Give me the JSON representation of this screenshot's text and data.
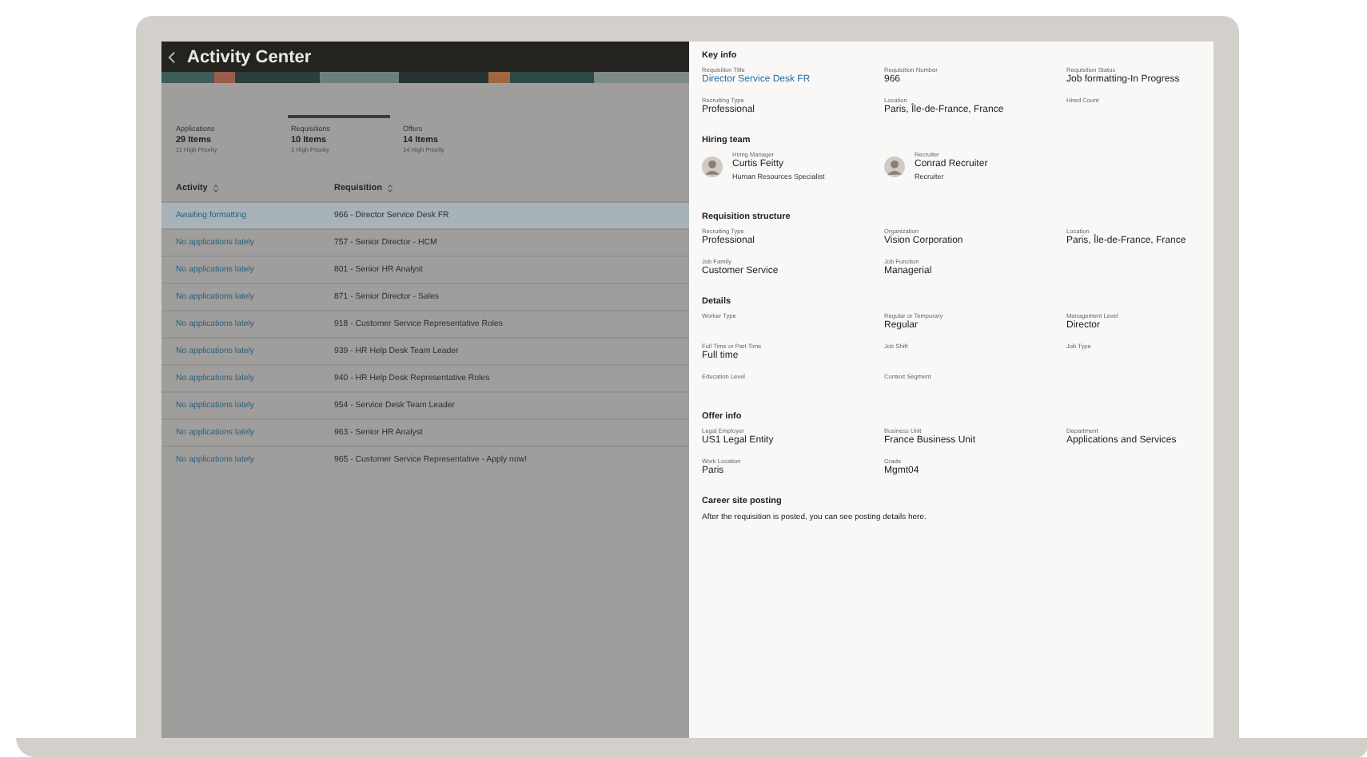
{
  "header": {
    "title": "Activity Center"
  },
  "tabs": [
    {
      "label": "Applications",
      "count": "29 Items",
      "priority": "11 High Priority",
      "selected": false
    },
    {
      "label": "Requisitions",
      "count": "10 Items",
      "priority": "1 High Priority",
      "selected": true
    },
    {
      "label": "Offers",
      "count": "14 Items",
      "priority": "14 High Priority",
      "selected": false
    }
  ],
  "table": {
    "columns": [
      {
        "label": "Activity"
      },
      {
        "label": "Requisition"
      }
    ],
    "rows": [
      {
        "activity": "Awaiting formatting",
        "requisition": "966 - Director Service Desk FR",
        "selected": true
      },
      {
        "activity": "No applications lately",
        "requisition": "757 - Senior Director - HCM",
        "selected": false
      },
      {
        "activity": "No applications lately",
        "requisition": "801 - Senior HR Analyst",
        "selected": false
      },
      {
        "activity": "No applications lately",
        "requisition": "871 - Senior Director - Sales",
        "selected": false
      },
      {
        "activity": "No applications lately",
        "requisition": "918 - Customer Service Representative Roles",
        "selected": false
      },
      {
        "activity": "No applications lately",
        "requisition": "939 - HR Help Desk Team Leader",
        "selected": false
      },
      {
        "activity": "No applications lately",
        "requisition": "940 - HR Help Desk Representative Roles",
        "selected": false
      },
      {
        "activity": "No applications lately",
        "requisition": "954 - Service Desk Team Leader",
        "selected": false
      },
      {
        "activity": "No applications lately",
        "requisition": "963 - Senior HR Analyst",
        "selected": false
      },
      {
        "activity": "No applications lately",
        "requisition": "965 - Customer Service Representative - Apply now!",
        "selected": false
      }
    ]
  },
  "panel": {
    "sections": [
      {
        "title": "Key info",
        "kind": "fields",
        "fields": [
          {
            "label": "Requisition Title",
            "value": "Director Service Desk FR",
            "link": true
          },
          {
            "label": "Requisition Number",
            "value": "966",
            "link": false
          },
          {
            "label": "Requisition Status",
            "value": "Job formatting-In Progress",
            "link": false
          },
          {
            "label": "Recruiting Type",
            "value": "Professional",
            "link": false
          },
          {
            "label": "Location",
            "value": "Paris, Île-de-France, France",
            "link": false
          },
          {
            "label": "Hired Count"
          }
        ]
      },
      {
        "title": "Hiring team",
        "kind": "people",
        "people": [
          {
            "role": "Hiring Manager",
            "name": "Curtis Feitty",
            "subtitle": "Human Resources Specialist"
          },
          {
            "role": "Recruiter",
            "name": "Conrad Recruiter",
            "subtitle": "Recruiter"
          }
        ]
      },
      {
        "title": "Requisition structure",
        "kind": "fields",
        "fields": [
          {
            "label": "Recruiting Type",
            "value": "Professional",
            "link": false
          },
          {
            "label": "Organization",
            "value": "Vision Corporation",
            "link": false
          },
          {
            "label": "Location",
            "value": "Paris, Île-de-France, France",
            "link": false
          },
          {
            "label": "Job Family",
            "value": "Customer Service",
            "link": false
          },
          {
            "label": "Job Function",
            "value": "Managerial",
            "link": false
          }
        ]
      },
      {
        "title": "Details",
        "kind": "fields",
        "fields": [
          {
            "label": "Worker Type"
          },
          {
            "label": "Regular or Temporary",
            "value": "Regular",
            "link": false
          },
          {
            "label": "Management Level",
            "value": "Director",
            "link": false
          },
          {
            "label": "Full Time or Part Time",
            "value": "Full time",
            "link": false
          },
          {
            "label": "Job Shift"
          },
          {
            "label": "Job Type"
          },
          {
            "label": "Education Level"
          },
          {
            "label": "Context Segment"
          }
        ]
      },
      {
        "title": "Offer info",
        "kind": "fields",
        "fields": [
          {
            "label": "Legal Employer",
            "value": "US1 Legal Entity",
            "link": false
          },
          {
            "label": "Business Unit",
            "value": "France Business Unit",
            "link": false
          },
          {
            "label": "Department",
            "value": "Applications and Services",
            "link": false
          },
          {
            "label": "Work Location",
            "value": "Paris",
            "link": false
          },
          {
            "label": "Grade",
            "value": "Mgmt04",
            "link": false
          }
        ]
      },
      {
        "title": "Career site posting",
        "kind": "text",
        "text": "After the requisition is posted, you can see posting details here."
      }
    ]
  }
}
